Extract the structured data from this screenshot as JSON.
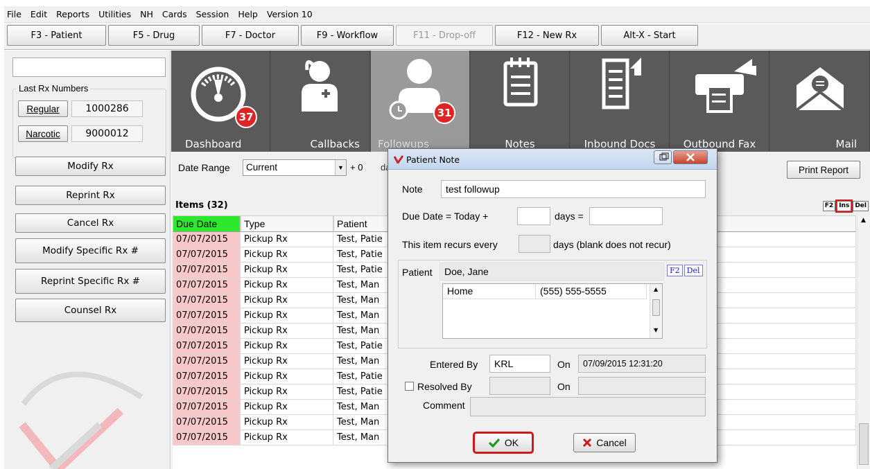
{
  "menu": [
    "File",
    "Edit",
    "Reports",
    "Utilities",
    "NH",
    "Cards",
    "Session",
    "Help",
    "Version 10"
  ],
  "toolbar": {
    "patient": "F3 - Patient",
    "drug": "F5 - Drug",
    "doctor": "F7 - Doctor",
    "workflow": "F9 - Workflow",
    "dropoff": "F11 - Drop-off",
    "newrx": "F12 - New Rx",
    "start": "Alt-X - Start"
  },
  "left": {
    "last_rx_title": "Last Rx Numbers",
    "regular_label": "Regular",
    "regular_value": "1000286",
    "narcotic_label": "Narcotic",
    "narcotic_value": "9000012",
    "buttons": [
      "Modify Rx",
      "Reprint Rx",
      "Cancel Rx",
      "Modify Specific Rx #",
      "Reprint Specific Rx #",
      "Counsel Rx"
    ]
  },
  "tiles": {
    "dashboard": {
      "label": "Dashboard",
      "badge": "37"
    },
    "callbacks": {
      "label": "Callbacks"
    },
    "followups": {
      "label": "Followups",
      "badge": "31"
    },
    "notes": {
      "label": "Notes"
    },
    "inbound": {
      "label": "Inbound Docs"
    },
    "outbound": {
      "label": "Outbound Fax"
    },
    "mail": {
      "label": "Mail"
    }
  },
  "filter": {
    "date_range_label": "Date Range",
    "date_range_value": "Current",
    "plus_label": "+ 0",
    "trailing_label": "da"
  },
  "print_report": "Print Report",
  "items_label": "Items (32)",
  "small_buttons": {
    "f2": "F2",
    "ins": "Ins",
    "del": "Del"
  },
  "grid": {
    "columns": [
      "Due Date",
      "Type",
      "Patient"
    ],
    "rows": [
      [
        "07/07/2015",
        "Pickup Rx",
        "Test, Patie"
      ],
      [
        "07/07/2015",
        "Pickup Rx",
        "Test, Patie"
      ],
      [
        "07/07/2015",
        "Pickup Rx",
        "Test, Patie"
      ],
      [
        "07/07/2015",
        "Pickup Rx",
        "Test, Man"
      ],
      [
        "07/07/2015",
        "Pickup Rx",
        "Test, Man"
      ],
      [
        "07/07/2015",
        "Pickup Rx",
        "Test, Man"
      ],
      [
        "07/07/2015",
        "Pickup Rx",
        "Test, Man"
      ],
      [
        "07/07/2015",
        "Pickup Rx",
        "Test, Patie"
      ],
      [
        "07/07/2015",
        "Pickup Rx",
        "Test, Man"
      ],
      [
        "07/07/2015",
        "Pickup Rx",
        "Test, Patie"
      ],
      [
        "07/07/2015",
        "Pickup Rx",
        "Test, Patie"
      ],
      [
        "07/07/2015",
        "Pickup Rx",
        "Test, Man"
      ],
      [
        "07/07/2015",
        "Pickup Rx",
        "Test, Man"
      ],
      [
        "07/07/2015",
        "Pickup Rx",
        "Test, Man"
      ]
    ]
  },
  "dialog": {
    "title": "Patient Note",
    "note_label": "Note",
    "note_value": "test followup",
    "due_label": "Due Date = Today +",
    "days_eq": "days =",
    "recurs_label": "This item recurs every",
    "recurs_suffix": "days (blank does not recur)",
    "patient_label": "Patient",
    "patient_value": "Doe, Jane",
    "f2": "F2",
    "del": "Del",
    "phone_type": "Home",
    "phone_number": "(555) 555-5555",
    "entered_by_label": "Entered By",
    "entered_by_value": "KRL",
    "on_label": "On",
    "entered_on_value": "07/09/2015 12:31:20",
    "resolved_label": "Resolved By",
    "comment_label": "Comment",
    "ok": "OK",
    "cancel": "Cancel"
  }
}
